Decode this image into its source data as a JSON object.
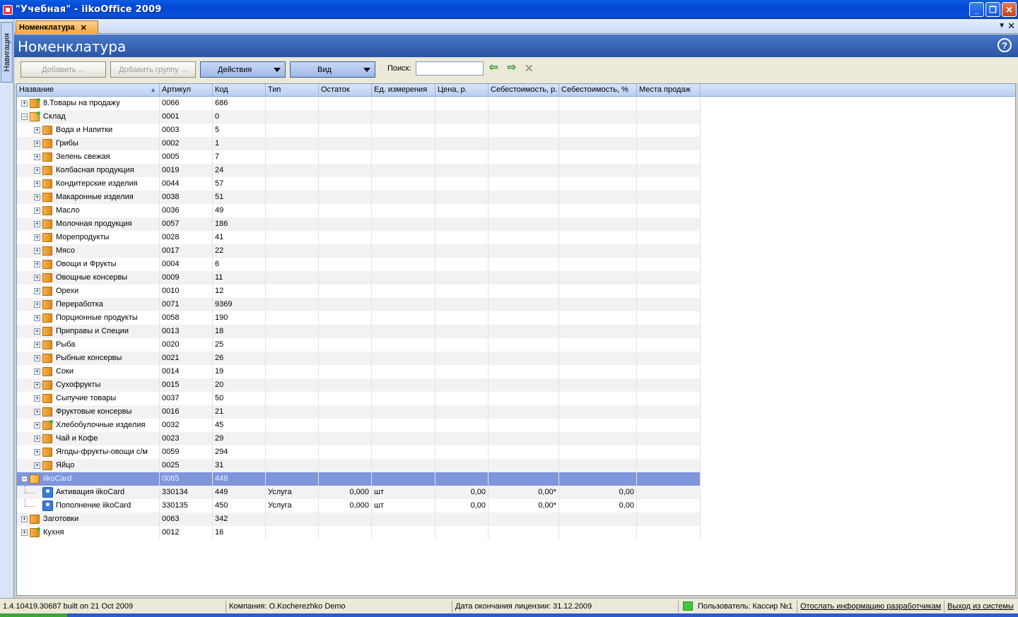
{
  "window": {
    "title": "\"Учебная\" - iikoOffice 2009"
  },
  "navigation": {
    "tab_label": "Навигация"
  },
  "tabs": [
    {
      "label": "Номенклатура"
    }
  ],
  "page": {
    "title": "Номенклатура",
    "help": "?"
  },
  "toolbar": {
    "add_label": "Добавить ...",
    "add_group_label": "Добавить группу ...",
    "actions_label": "Действия",
    "view_label": "Вид",
    "search_label": "Поиск:",
    "search_value": ""
  },
  "columns": [
    "Название",
    "Артикул",
    "Код",
    "Тип",
    "Остаток",
    "Ед. измерения",
    "Цена, р.",
    "Себестоимость, р.",
    "Себестоимость, %",
    "Места продаж"
  ],
  "rows": [
    {
      "level": 0,
      "expander": "+",
      "icon": "folder-green",
      "name": "8.Товары на продажу",
      "article": "0066",
      "code": "686",
      "type": "",
      "stock": "",
      "unit": "",
      "price": "",
      "cost": "",
      "cost_pct": ""
    },
    {
      "level": 0,
      "expander": "-",
      "icon": "folder-open-green",
      "name": "Склад",
      "article": "0001",
      "code": "0",
      "type": "",
      "stock": "",
      "unit": "",
      "price": "",
      "cost": "",
      "cost_pct": ""
    },
    {
      "level": 1,
      "expander": "+",
      "icon": "folder",
      "name": "Вода и Напитки",
      "article": "0003",
      "code": "5",
      "type": "",
      "stock": "",
      "unit": "",
      "price": "",
      "cost": "",
      "cost_pct": ""
    },
    {
      "level": 1,
      "expander": "+",
      "icon": "folder",
      "name": "Грибы",
      "article": "0002",
      "code": "1",
      "type": "",
      "stock": "",
      "unit": "",
      "price": "",
      "cost": "",
      "cost_pct": ""
    },
    {
      "level": 1,
      "expander": "+",
      "icon": "folder",
      "name": "Зелень свежая",
      "article": "0005",
      "code": "7",
      "type": "",
      "stock": "",
      "unit": "",
      "price": "",
      "cost": "",
      "cost_pct": ""
    },
    {
      "level": 1,
      "expander": "+",
      "icon": "folder",
      "name": "Колбасная продукция",
      "article": "0019",
      "code": "24",
      "type": "",
      "stock": "",
      "unit": "",
      "price": "",
      "cost": "",
      "cost_pct": ""
    },
    {
      "level": 1,
      "expander": "+",
      "icon": "folder",
      "name": "Кондитерские  изделия",
      "article": "0044",
      "code": "57",
      "type": "",
      "stock": "",
      "unit": "",
      "price": "",
      "cost": "",
      "cost_pct": ""
    },
    {
      "level": 1,
      "expander": "+",
      "icon": "folder",
      "name": "Макаронные изделия",
      "article": "0038",
      "code": "51",
      "type": "",
      "stock": "",
      "unit": "",
      "price": "",
      "cost": "",
      "cost_pct": ""
    },
    {
      "level": 1,
      "expander": "+",
      "icon": "folder",
      "name": "Масло",
      "article": "0036",
      "code": "49",
      "type": "",
      "stock": "",
      "unit": "",
      "price": "",
      "cost": "",
      "cost_pct": ""
    },
    {
      "level": 1,
      "expander": "+",
      "icon": "folder",
      "name": "Молочная продукция",
      "article": "0057",
      "code": "186",
      "type": "",
      "stock": "",
      "unit": "",
      "price": "",
      "cost": "",
      "cost_pct": ""
    },
    {
      "level": 1,
      "expander": "+",
      "icon": "folder",
      "name": "Морепродукты",
      "article": "0028",
      "code": "41",
      "type": "",
      "stock": "",
      "unit": "",
      "price": "",
      "cost": "",
      "cost_pct": ""
    },
    {
      "level": 1,
      "expander": "+",
      "icon": "folder",
      "name": "Мясо",
      "article": "0017",
      "code": "22",
      "type": "",
      "stock": "",
      "unit": "",
      "price": "",
      "cost": "",
      "cost_pct": ""
    },
    {
      "level": 1,
      "expander": "+",
      "icon": "folder",
      "name": "Овощи и Фрукты",
      "article": "0004",
      "code": "6",
      "type": "",
      "stock": "",
      "unit": "",
      "price": "",
      "cost": "",
      "cost_pct": ""
    },
    {
      "level": 1,
      "expander": "+",
      "icon": "folder",
      "name": "Овощные консервы",
      "article": "0009",
      "code": "11",
      "type": "",
      "stock": "",
      "unit": "",
      "price": "",
      "cost": "",
      "cost_pct": ""
    },
    {
      "level": 1,
      "expander": "+",
      "icon": "folder",
      "name": "Орехи",
      "article": "0010",
      "code": "12",
      "type": "",
      "stock": "",
      "unit": "",
      "price": "",
      "cost": "",
      "cost_pct": ""
    },
    {
      "level": 1,
      "expander": "+",
      "icon": "folder",
      "name": "Переработка",
      "article": "0071",
      "code": "9369",
      "type": "",
      "stock": "",
      "unit": "",
      "price": "",
      "cost": "",
      "cost_pct": ""
    },
    {
      "level": 1,
      "expander": "+",
      "icon": "folder",
      "name": "Порционные продукты",
      "article": "0058",
      "code": "190",
      "type": "",
      "stock": "",
      "unit": "",
      "price": "",
      "cost": "",
      "cost_pct": ""
    },
    {
      "level": 1,
      "expander": "+",
      "icon": "folder",
      "name": "Приправы и Специи",
      "article": "0013",
      "code": "18",
      "type": "",
      "stock": "",
      "unit": "",
      "price": "",
      "cost": "",
      "cost_pct": ""
    },
    {
      "level": 1,
      "expander": "+",
      "icon": "folder",
      "name": "Рыба",
      "article": "0020",
      "code": "25",
      "type": "",
      "stock": "",
      "unit": "",
      "price": "",
      "cost": "",
      "cost_pct": ""
    },
    {
      "level": 1,
      "expander": "+",
      "icon": "folder",
      "name": "Рыбные консервы",
      "article": "0021",
      "code": "26",
      "type": "",
      "stock": "",
      "unit": "",
      "price": "",
      "cost": "",
      "cost_pct": ""
    },
    {
      "level": 1,
      "expander": "+",
      "icon": "folder",
      "name": "Соки",
      "article": "0014",
      "code": "19",
      "type": "",
      "stock": "",
      "unit": "",
      "price": "",
      "cost": "",
      "cost_pct": ""
    },
    {
      "level": 1,
      "expander": "+",
      "icon": "folder",
      "name": "Сухофрукты",
      "article": "0015",
      "code": "20",
      "type": "",
      "stock": "",
      "unit": "",
      "price": "",
      "cost": "",
      "cost_pct": ""
    },
    {
      "level": 1,
      "expander": "+",
      "icon": "folder",
      "name": "Сыпучие товары",
      "article": "0037",
      "code": "50",
      "type": "",
      "stock": "",
      "unit": "",
      "price": "",
      "cost": "",
      "cost_pct": ""
    },
    {
      "level": 1,
      "expander": "+",
      "icon": "folder",
      "name": "Фруктовые  консервы",
      "article": "0016",
      "code": "21",
      "type": "",
      "stock": "",
      "unit": "",
      "price": "",
      "cost": "",
      "cost_pct": ""
    },
    {
      "level": 1,
      "expander": "+",
      "icon": "folder-green",
      "name": "Хлебобулочные изделия",
      "article": "0032",
      "code": "45",
      "type": "",
      "stock": "",
      "unit": "",
      "price": "",
      "cost": "",
      "cost_pct": ""
    },
    {
      "level": 1,
      "expander": "+",
      "icon": "folder",
      "name": "Чай и Кофе",
      "article": "0023",
      "code": "29",
      "type": "",
      "stock": "",
      "unit": "",
      "price": "",
      "cost": "",
      "cost_pct": ""
    },
    {
      "level": 1,
      "expander": "+",
      "icon": "folder",
      "name": "Ягоды-фрукты-овощи с/м",
      "article": "0059",
      "code": "294",
      "type": "",
      "stock": "",
      "unit": "",
      "price": "",
      "cost": "",
      "cost_pct": ""
    },
    {
      "level": 1,
      "expander": "+",
      "icon": "folder",
      "name": "Яйцо",
      "article": "0025",
      "code": "31",
      "type": "",
      "stock": "",
      "unit": "",
      "price": "",
      "cost": "",
      "cost_pct": ""
    },
    {
      "level": 0,
      "expander": "-",
      "icon": "folder-open",
      "name": "iikoCard",
      "article": "0065",
      "code": "448",
      "type": "",
      "stock": "",
      "unit": "",
      "price": "",
      "cost": "",
      "cost_pct": "",
      "selected": true
    },
    {
      "level": 1,
      "expander": "",
      "icon": "service",
      "name": "Активация iikoCard",
      "article": "330134",
      "code": "449",
      "type": "Услуга",
      "stock": "0,000",
      "unit": "шт",
      "price": "0,00",
      "cost": "0,00*",
      "cost_pct": "0,00"
    },
    {
      "level": 1,
      "expander": "",
      "icon": "service",
      "name": "Пополнение iikoCard",
      "article": "330135",
      "code": "450",
      "type": "Услуга",
      "stock": "0,000",
      "unit": "шт",
      "price": "0,00",
      "cost": "0,00*",
      "cost_pct": "0,00"
    },
    {
      "level": 0,
      "expander": "+",
      "icon": "folder",
      "name": "Заготовки",
      "article": "0063",
      "code": "342",
      "type": "",
      "stock": "",
      "unit": "",
      "price": "",
      "cost": "",
      "cost_pct": ""
    },
    {
      "level": 0,
      "expander": "+",
      "icon": "folder-green",
      "name": "Кухня",
      "article": "0012",
      "code": "16",
      "type": "",
      "stock": "",
      "unit": "",
      "price": "",
      "cost": "",
      "cost_pct": ""
    }
  ],
  "status": {
    "build": "1.4.10419.30687 built on 21 Oct 2009",
    "company": "Компания: O.Kocherezhko Demo",
    "license": "Дата окончания лицензии: 31.12.2009",
    "user": "Пользователь: Кассир №1",
    "report_link": "Отослать информацию разработчикам",
    "logout_link": "Выход из системы"
  }
}
